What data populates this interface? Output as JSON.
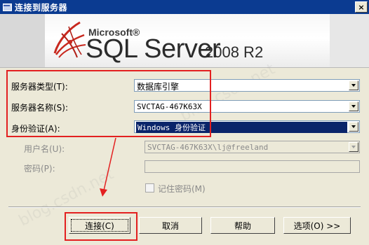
{
  "window": {
    "title": "连接到服务器",
    "close_glyph": "×"
  },
  "banner": {
    "brand": "Microsoft®",
    "product": "SQL Server",
    "version": "2008 R2"
  },
  "form": {
    "server_type": {
      "label": "服务器类型(T):",
      "value": "数据库引擎"
    },
    "server_name": {
      "label": "服务器名称(S):",
      "value": "SVCTAG-467K63X"
    },
    "authentication": {
      "label": "身份验证(A):",
      "value": "Windows 身份验证"
    },
    "username": {
      "label": "用户名(U):",
      "value": "SVCTAG-467K63X\\lj@freeland"
    },
    "password": {
      "label": "密码(P):",
      "value": ""
    },
    "remember_password": {
      "label": "记住密码(M)",
      "checked": false
    }
  },
  "buttons": {
    "connect": "连接(C)",
    "cancel": "取消",
    "help": "帮助",
    "options": "选项(O) >>"
  },
  "colors": {
    "titlebar": "#0b3b91",
    "highlight_box": "#e32020",
    "selection": "#0a246a"
  }
}
